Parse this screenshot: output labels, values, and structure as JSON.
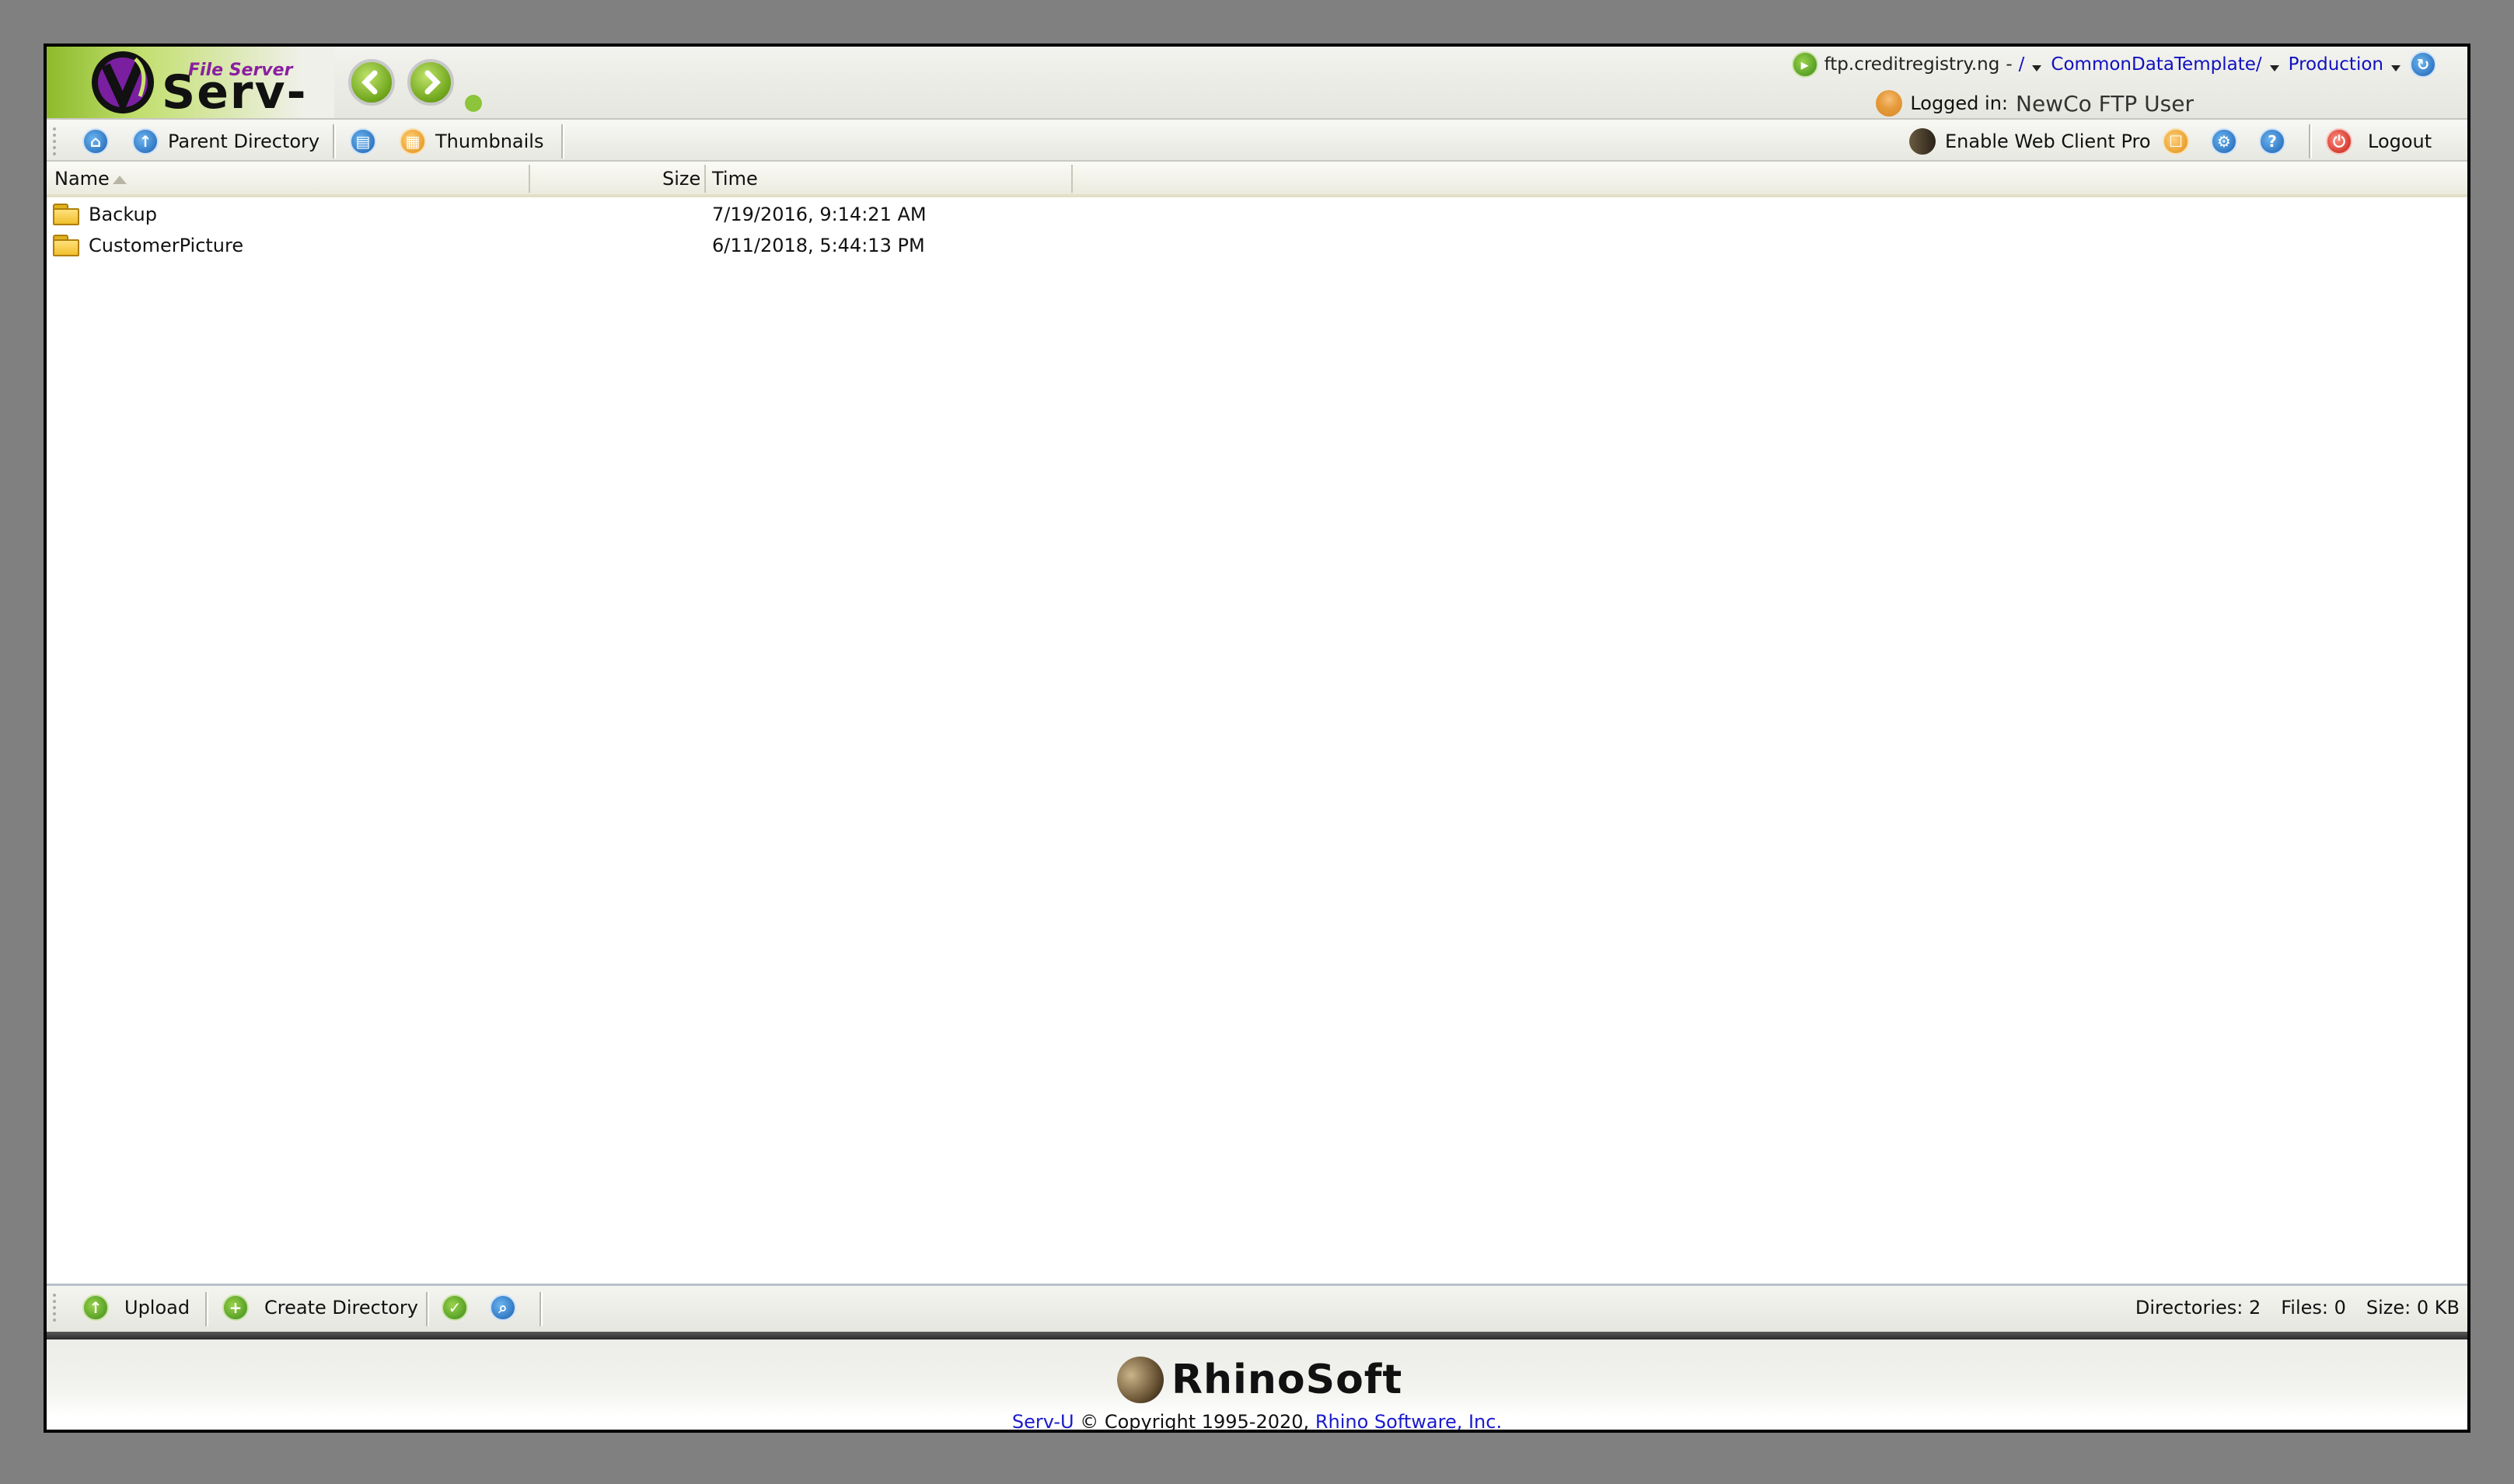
{
  "header": {
    "logo_subtitle": "File Server",
    "logo_title": "Serv-U",
    "server_host": "ftp.creditregistry.ng",
    "path_separator": "-",
    "path_root": "/",
    "path_folder": "CommonDataTemplate/",
    "path_current": "Production",
    "logged_in_label": "Logged in:",
    "logged_in_user": "NewCo FTP User"
  },
  "toolbar": {
    "parent_directory": "Parent Directory",
    "thumbnails": "Thumbnails",
    "enable_web_client_pro": "Enable Web Client Pro",
    "logout": "Logout"
  },
  "columns": {
    "name": "Name",
    "size": "Size",
    "time": "Time"
  },
  "files": [
    {
      "name": "Backup",
      "size": "",
      "time": "7/19/2016, 9:14:21 AM",
      "type": "folder"
    },
    {
      "name": "CustomerPicture",
      "size": "",
      "time": "6/11/2018, 5:44:13 PM",
      "type": "folder"
    }
  ],
  "bottombar": {
    "upload": "Upload",
    "create_directory": "Create Directory",
    "directories": "Directories: 2",
    "files": "Files: 0",
    "size": "Size: 0 KB"
  },
  "footer": {
    "brand": "RhinoSoft",
    "serv_u_link": "Serv-U",
    "copyright_text": "© Copyright 1995-2020,",
    "company_link": "Rhino Software, Inc."
  },
  "colors": {
    "link": "#1010c0",
    "logo_green": "#8dbb2c",
    "background": "#808080"
  }
}
